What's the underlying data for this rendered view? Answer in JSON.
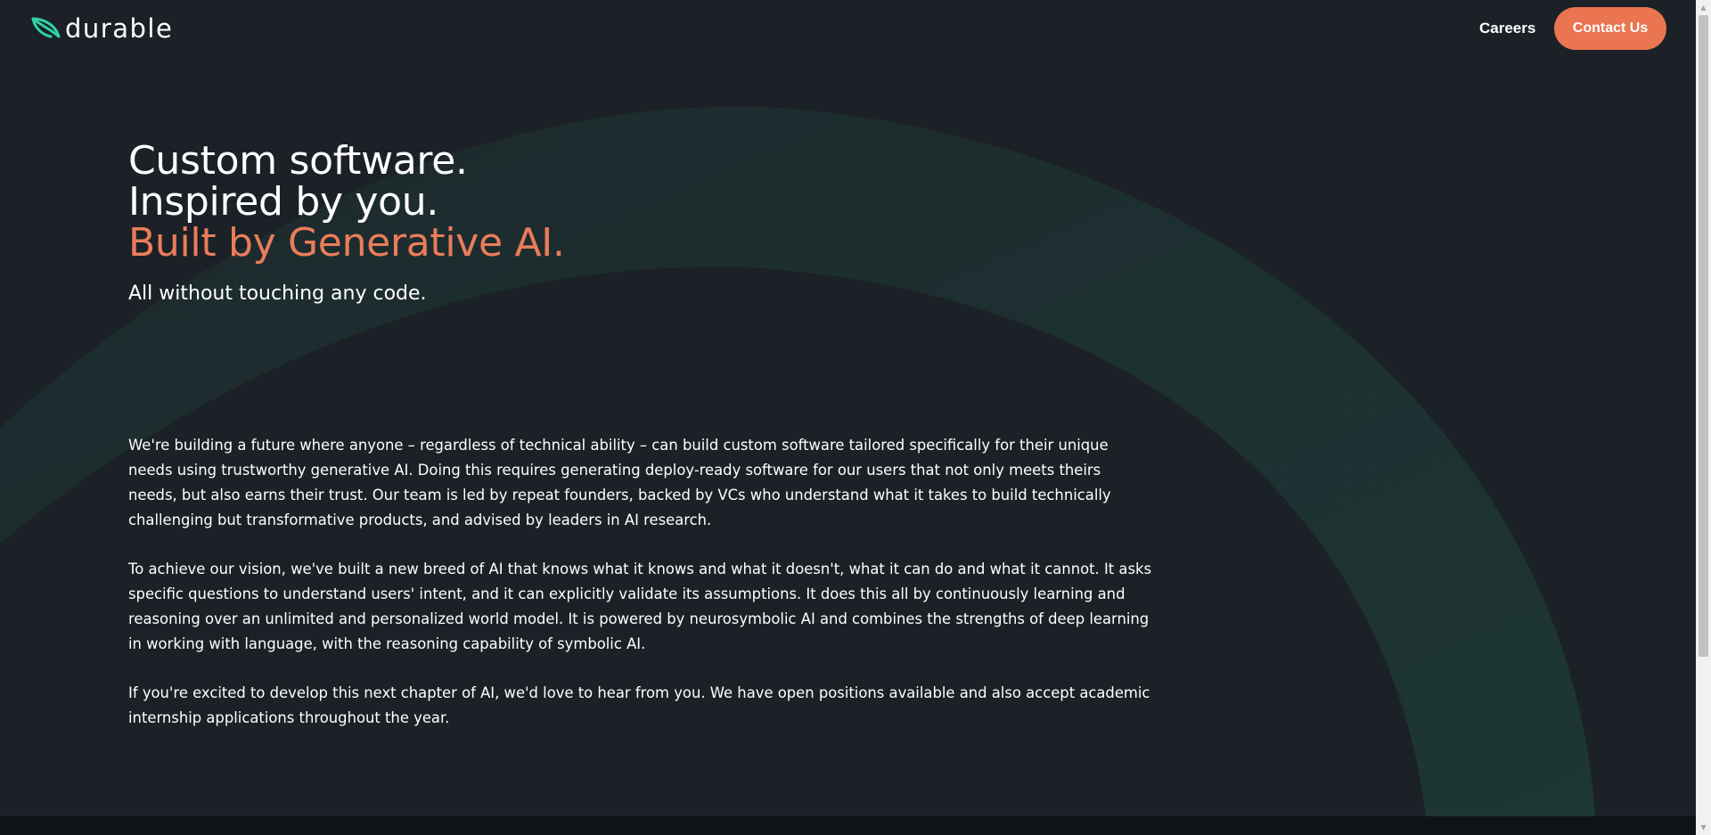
{
  "header": {
    "logo_text": "durable",
    "logo_icon": "durable-leaf-logo-icon",
    "nav_careers": "Careers",
    "nav_contact": "Contact Us"
  },
  "hero": {
    "line1": "Custom software.",
    "line2": "Inspired by you.",
    "line3": "Built by Generative AI.",
    "subtitle": "All without touching any code."
  },
  "body": {
    "paragraph1": "We're building a future where anyone – regardless of technical ability – can build custom software tailored specifically for their unique needs using trustworthy generative AI. Doing this requires generating deploy-ready software for our users that not only meets theirs needs, but also earns their trust. Our team is led by repeat founders, backed by VCs who understand what it takes to build technically challenging but transformative products, and advised by leaders in AI research.",
    "paragraph2": "To achieve our vision, we've built a new breed of AI that knows what it knows and what it doesn't, what it can do and what it cannot. It asks specific questions to understand users' intent, and it can explicitly validate its assumptions. It does this all by continuously learning and reasoning over an unlimited and personalized world model. It is powered by neurosymbolic AI and combines the strengths of deep learning in working with language, with the reasoning capability of symbolic AI.",
    "paragraph3": "If you're excited to develop this next chapter of AI, we'd love to hear from you. We have open positions available and also accept academic internship applications throughout the year."
  },
  "colors": {
    "background": "#1b2126",
    "accent": "#ea7550",
    "accent_text": "#ea7d5a",
    "logo_green": "#2fd3a5",
    "arc_green": "#1d3836"
  }
}
